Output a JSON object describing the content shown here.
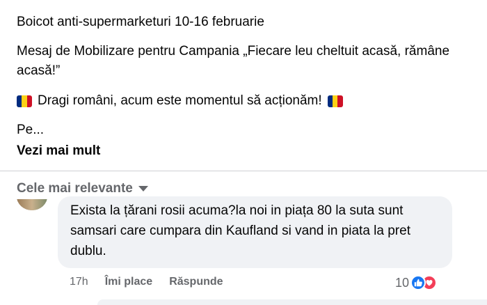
{
  "post": {
    "line1": "Boicot anti-supermarketuri 10-16 februarie",
    "line2": "Mesaj de Mobilizare pentru Campania „Fiecare leu cheltuit acasă, rămâne acasă!”",
    "line3": "Dragi români, acum este momentul să acționăm!",
    "line4": "Pe...",
    "see_more": "Vezi mai mult",
    "flag_colors": [
      "#002B7F",
      "#FCD116",
      "#CE1126"
    ]
  },
  "sort": {
    "label": "Cele mai relevante"
  },
  "comment": {
    "text": "Exista la țărani rosii acuma?la noi in piața 80 la suta sunt samsari care cumpara din Kaufland si vand in piata la pret dublu.",
    "time": "17h",
    "like_label": "Îmi place",
    "reply_label": "Răspunde",
    "reaction_count": "10",
    "reaction_icons": [
      "like-icon",
      "love-icon"
    ],
    "colors": {
      "like": "#1877f2",
      "love": "#f33e58"
    }
  }
}
